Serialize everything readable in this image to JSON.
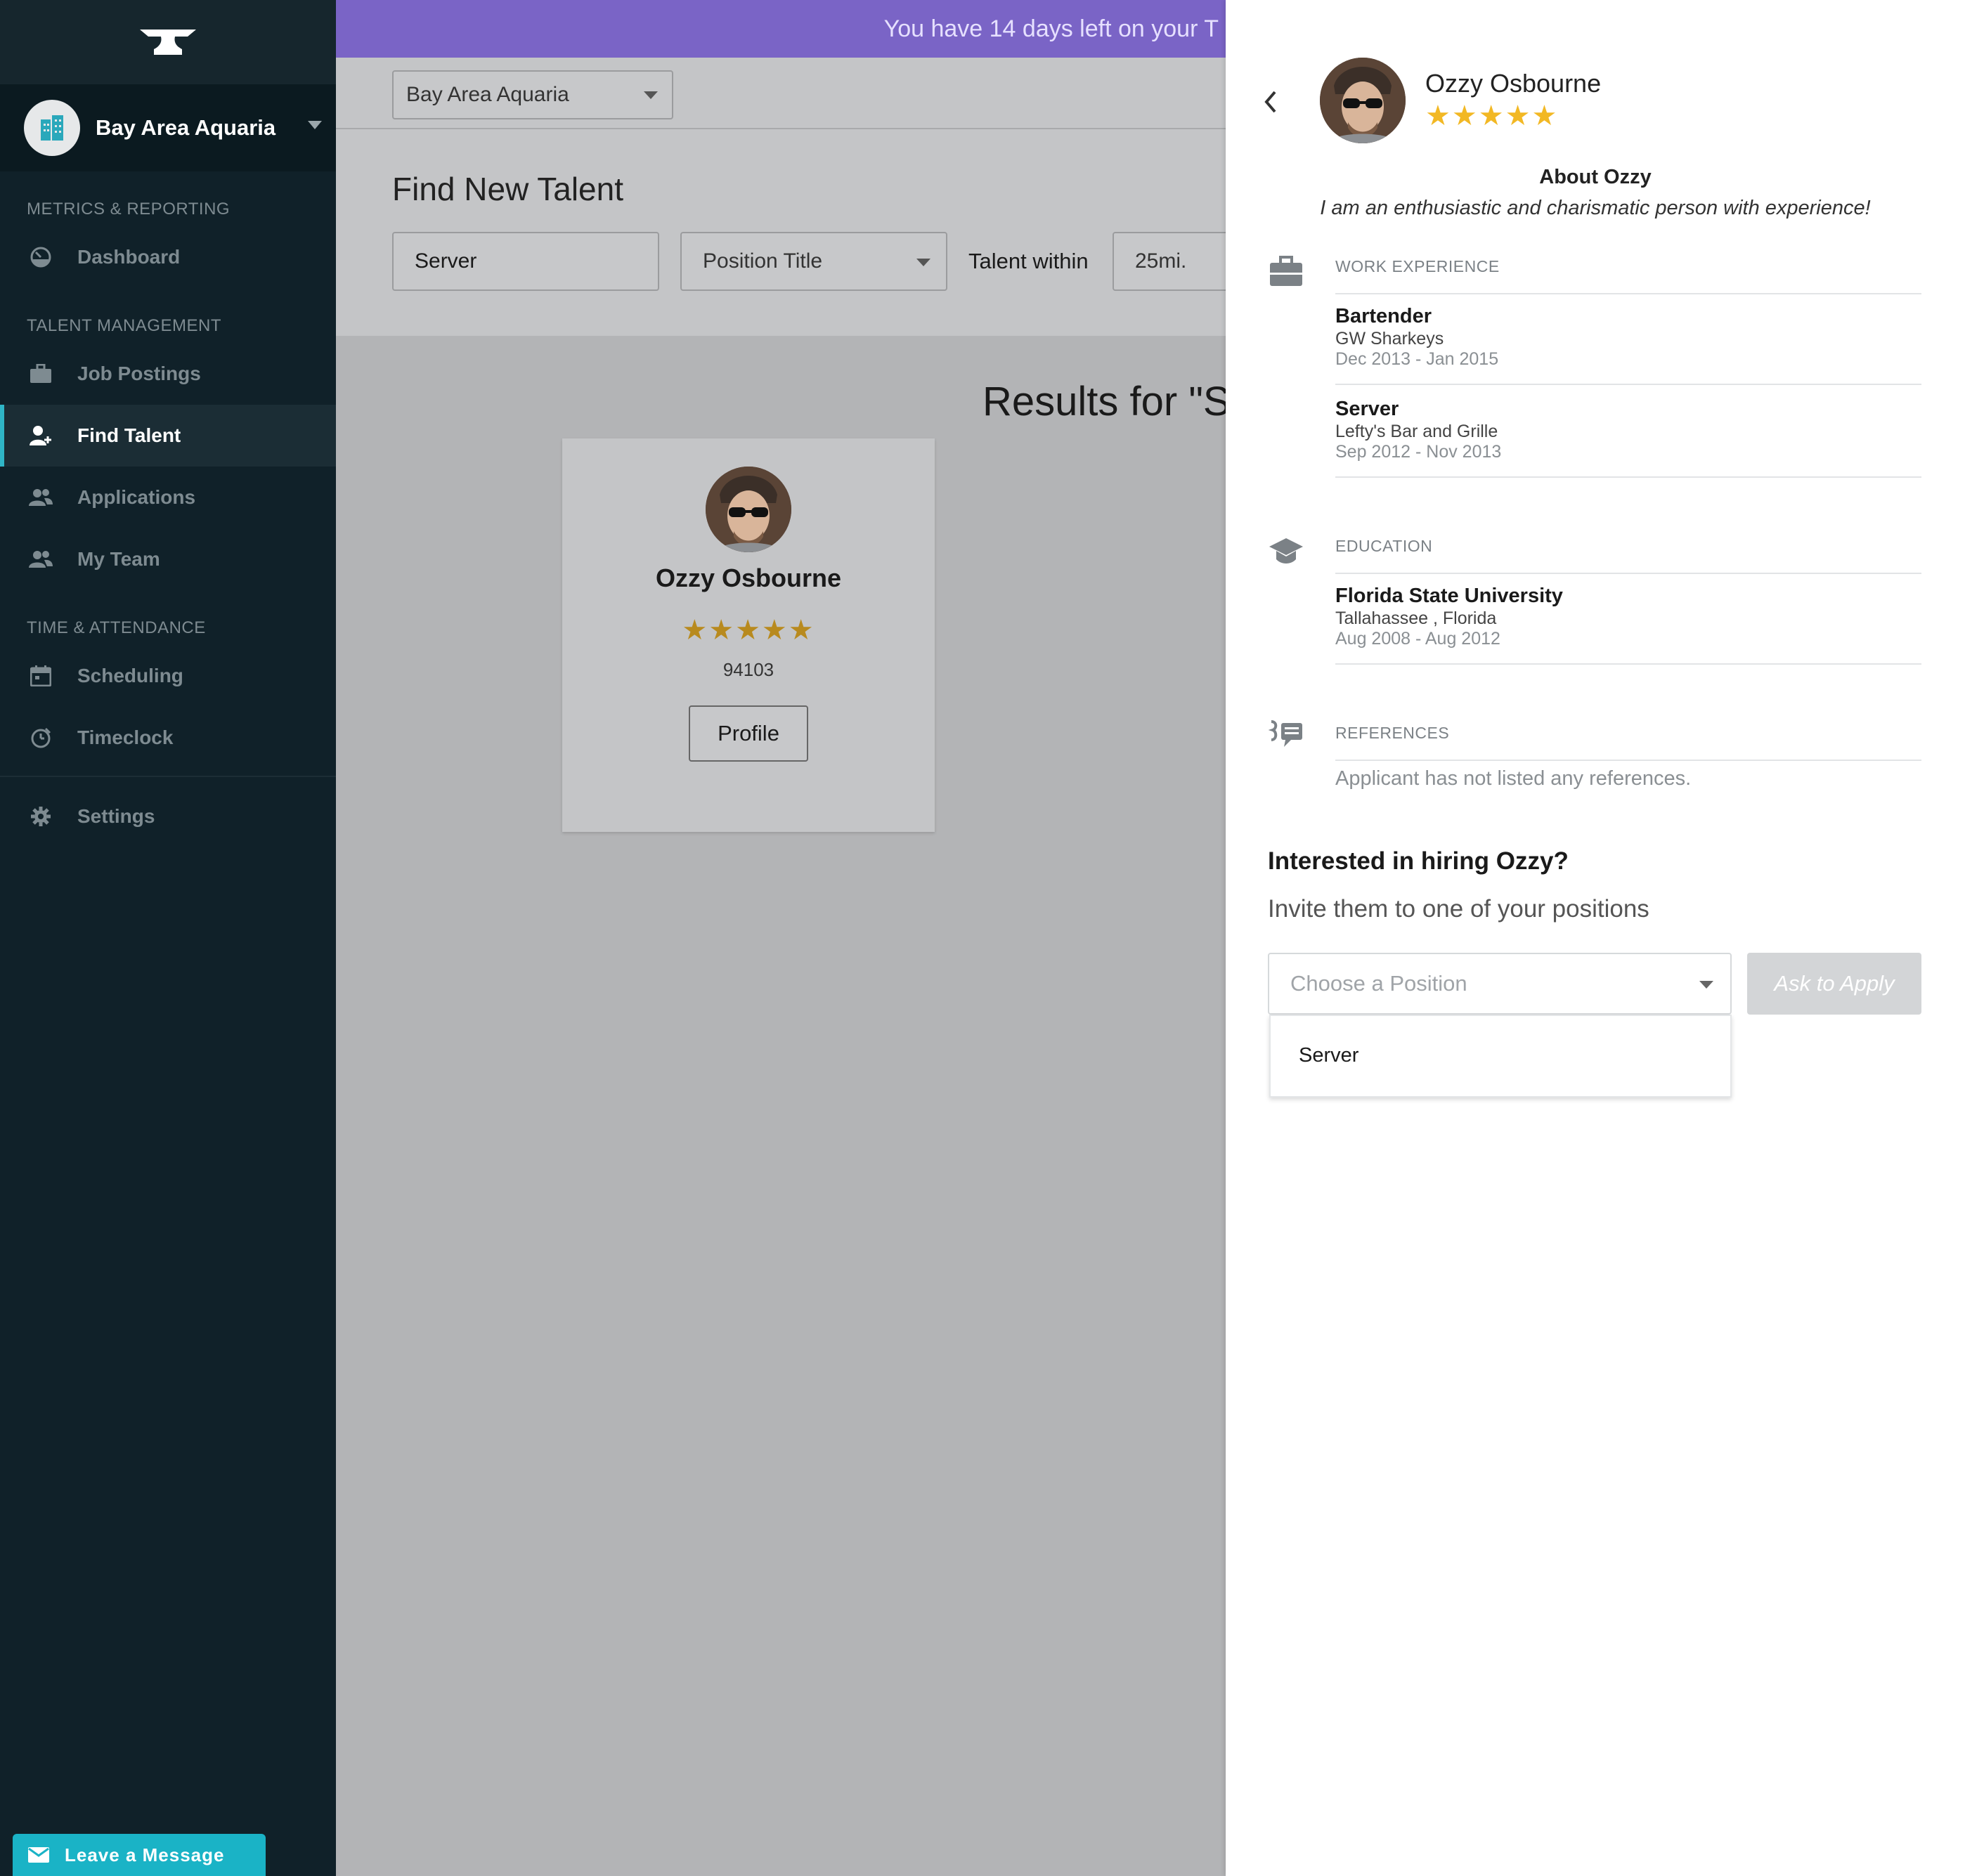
{
  "sidebar": {
    "account_name": "Bay Area Aquaria",
    "sections": {
      "metrics": "METRICS & REPORTING",
      "talent": "TALENT MANAGEMENT",
      "time": "TIME & ATTENDANCE"
    },
    "items": [
      {
        "label": "Dashboard",
        "icon": "dashboard-icon"
      },
      {
        "label": "Job Postings",
        "icon": "briefcase-icon"
      },
      {
        "label": "Find Talent",
        "icon": "add-user-icon",
        "active": true
      },
      {
        "label": "Applications",
        "icon": "users-icon"
      },
      {
        "label": "My Team",
        "icon": "team-icon"
      },
      {
        "label": "Scheduling",
        "icon": "calendar-icon"
      },
      {
        "label": "Timeclock",
        "icon": "clock-icon"
      },
      {
        "label": "Settings",
        "icon": "gear-icon"
      }
    ],
    "leave_message": "Leave a Message"
  },
  "banner": {
    "text": "You have 14 days left on your T"
  },
  "topbar": {
    "location_select": "Bay Area Aquaria"
  },
  "search": {
    "title": "Find New Talent",
    "keyword_value": "Server",
    "position_select": "Position Title",
    "within_label": "Talent within",
    "distance_select": "25mi."
  },
  "results": {
    "title": "Results for \"S",
    "cards": [
      {
        "name": "Ozzy Osbourne",
        "stars": "★★★★★",
        "zip": "94103",
        "button": "Profile"
      }
    ]
  },
  "profile": {
    "name": "Ozzy Osbourne",
    "stars": "★★★★★",
    "about_title": "About Ozzy",
    "about_text": "I am an enthusiastic and charismatic person with experience!",
    "work_header": "WORK EXPERIENCE",
    "work": [
      {
        "title": "Bartender",
        "place": "GW Sharkeys",
        "dates": "Dec 2013 - Jan 2015"
      },
      {
        "title": "Server",
        "place": "Lefty's Bar and Grille",
        "dates": "Sep 2012 - Nov 2013"
      }
    ],
    "education_header": "EDUCATION",
    "education": [
      {
        "title": "Florida State University",
        "place": "Tallahassee , Florida",
        "dates": "Aug 2008 - Aug 2012"
      }
    ],
    "references_header": "REFERENCES",
    "references_empty": "Applicant has not listed any references.",
    "hire_title": "Interested in hiring Ozzy?",
    "hire_sub": "Invite them to one of your positions",
    "position_placeholder": "Choose a Position",
    "ask_button": "Ask to Apply",
    "position_options": [
      "Server"
    ]
  },
  "colors": {
    "sidebar_bg": "#102129",
    "accent_teal": "#1ab3c6",
    "banner_purple": "#7a64c6",
    "star_gold": "#f2b824"
  }
}
